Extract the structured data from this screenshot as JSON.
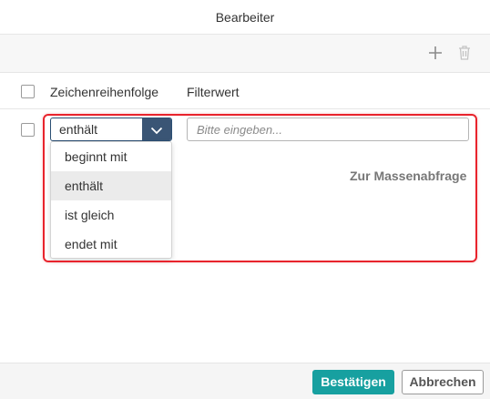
{
  "dialog": {
    "title": "Bearbeiter"
  },
  "toolbar": {
    "add_icon": "plus-icon",
    "delete_icon": "trash-icon"
  },
  "table": {
    "columns": [
      "Zeichenreihenfolge",
      "Filterwert"
    ]
  },
  "row": {
    "operator_value": "enthält",
    "filter_placeholder": "Bitte eingeben..."
  },
  "dropdown": {
    "options": [
      "beginnt mit",
      "enthält",
      "ist gleich",
      "endet mit"
    ],
    "selected": "enthält"
  },
  "bulk_query": {
    "label": "Zur Massenabfrage"
  },
  "footer": {
    "confirm_label": "Bestätigen",
    "cancel_label": "Abbrechen"
  },
  "colors": {
    "accent": "#17a0a0",
    "select_arrow_bg": "#3a5575",
    "highlight": "#e8232c"
  }
}
